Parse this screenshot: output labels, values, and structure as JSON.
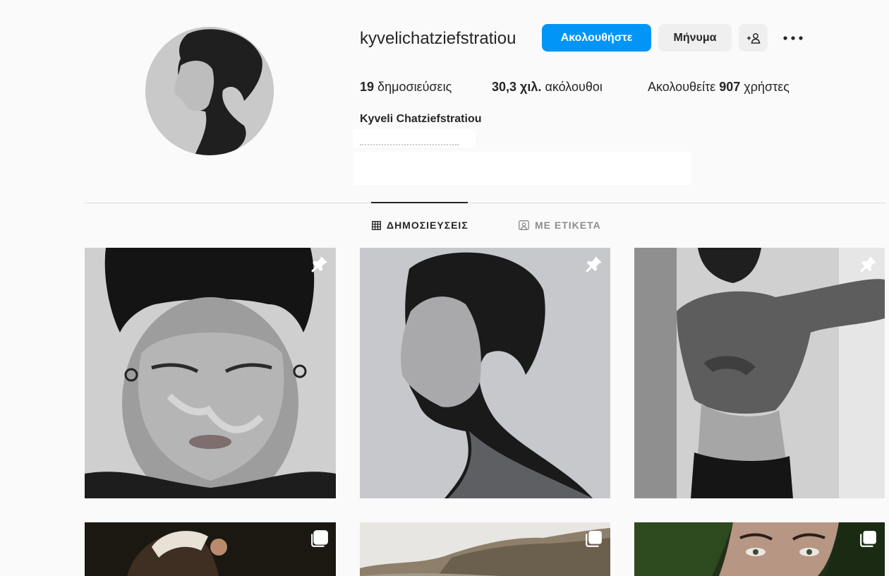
{
  "profile": {
    "username": "kyvelichatziefstratiou",
    "full_name": "Kyveli Chatziefstratiou",
    "follow_label": "Ακολουθήστε",
    "message_label": "Μήνυμα"
  },
  "stats": {
    "posts_count": "19",
    "posts_label": "δημοσιεύσεις",
    "followers_count": "30,3 χιλ.",
    "followers_label": "ακόλουθοι",
    "following_prefix": "Ακολουθείτε",
    "following_count": "907",
    "following_suffix": "χρήστες"
  },
  "tabs": [
    {
      "label": "ΔΗΜΟΣΙΕΥΣΕΙΣ",
      "icon": "grid-icon",
      "active": true
    },
    {
      "label": "ΜΕ ΕΤΙΚΕΤΑ",
      "icon": "tagged-icon",
      "active": false
    }
  ],
  "posts": [
    {
      "subject": "bw portrait with smoke",
      "badge": "pin-icon"
    },
    {
      "subject": "bw profile portrait",
      "badge": "pin-icon"
    },
    {
      "subject": "bw torso portrait",
      "badge": "pin-icon"
    },
    {
      "subject": "warm indoor portrait",
      "badge": "carousel-icon"
    },
    {
      "subject": "rocky hillside landscape",
      "badge": "carousel-icon"
    },
    {
      "subject": "close-up face with plants",
      "badge": "carousel-icon"
    }
  ],
  "colors": {
    "accent": "#0095f6",
    "text": "#262626",
    "muted": "#8e8e8e",
    "divider": "#dbdbdb"
  }
}
